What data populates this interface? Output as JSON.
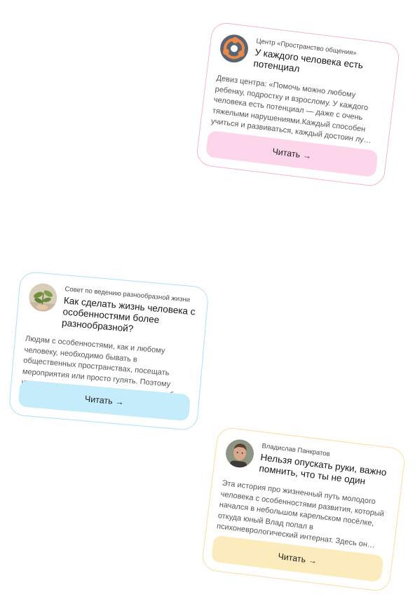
{
  "cards": [
    {
      "author": "Центр «Пространство общения»",
      "title": "У каждого человека есть потенциал",
      "excerpt": "Девиз центра: «Помочь можно любому ребенку, подростку и взрослому. У каждого человека есть потенциал — даже с очень тяжелыми нарушениями.Каждый способен учиться и развиваться, каждый достоин лу…",
      "button": "Читать",
      "button_icon": "arrow-right-icon",
      "avatar_icon": "community-logo-icon",
      "accent": "#fdd6ec",
      "border": "#f7b3d4"
    },
    {
      "author": "Совет по ведению разнообразной жизни",
      "title": "Как сделать жизнь человека с особенностями более разнообразной?",
      "excerpt": "Людям с особенностями, как и любому человеку, необходимо бывать в общественных пространствах, посещать мероприятия или просто гулять. Поэтому нужно стараться планировать как можно б…",
      "button": "Читать",
      "button_icon": "arrow-right-icon",
      "avatar_icon": "plant-photo",
      "accent": "#c5ecfb",
      "border": "#a9e2f6"
    },
    {
      "author": "Владислав Панкратов",
      "title": "Нельзя опускать руки, важно помнить, что ты не один",
      "excerpt": "Эта история про жизненный путь молодого человека с особенностями развития, который начался в небольшом карельском посёлке, откуда юный Влад попал в психоневрологический интернат. Здесь он…",
      "button": "Читать",
      "button_icon": "arrow-right-icon",
      "avatar_icon": "person-photo",
      "accent": "#fcebbd",
      "border": "#f8dea0"
    }
  ],
  "arrow_glyph": "→"
}
